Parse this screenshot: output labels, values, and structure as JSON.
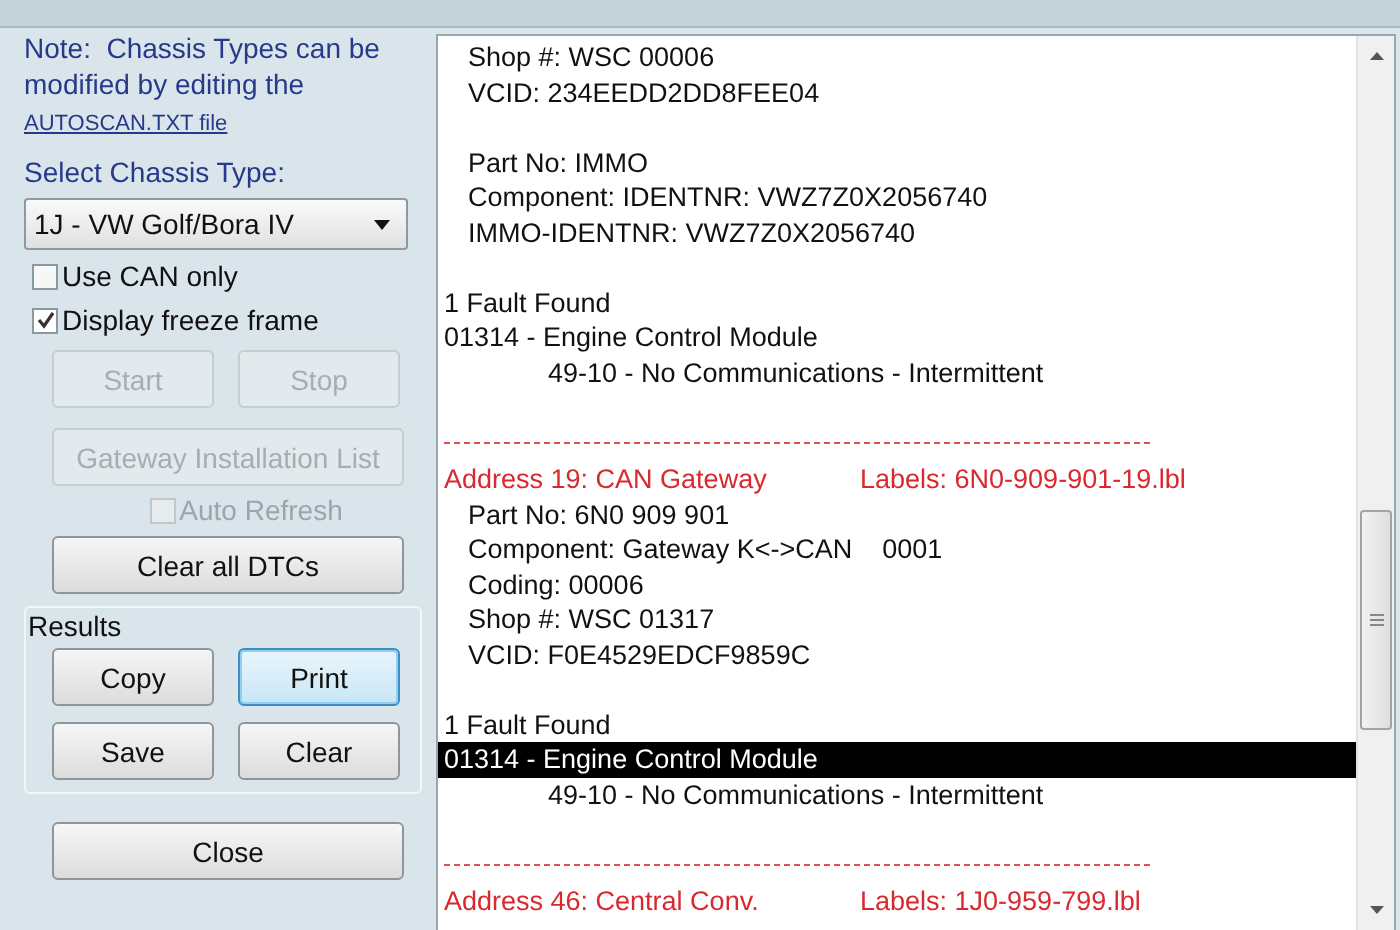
{
  "note": {
    "text": "Note:  Chassis Types can be modified by editing the",
    "link": "AUTOSCAN.TXT file"
  },
  "chassis": {
    "label": "Select Chassis Type:",
    "value": "1J - VW Golf/Bora IV"
  },
  "options": [
    {
      "label": "Use CAN only",
      "checked": false
    },
    {
      "label": "Display freeze frame",
      "checked": true
    }
  ],
  "run_buttons": [
    {
      "label": "Start",
      "disabled": true
    },
    {
      "label": "Stop",
      "disabled": true
    }
  ],
  "gateway_button": {
    "label": "Gateway Installation List",
    "disabled": true
  },
  "auto_refresh": {
    "label": "Auto Refresh",
    "checked": false,
    "disabled": true
  },
  "clear_dtcs_button": {
    "label": "Clear all DTCs",
    "disabled": false
  },
  "results": {
    "title": "Results",
    "buttons": [
      {
        "label": "Copy",
        "focused": false
      },
      {
        "label": "Print",
        "focused": true
      },
      {
        "label": "Save",
        "focused": false
      },
      {
        "label": "Clear",
        "focused": false
      }
    ]
  },
  "close_button": {
    "label": "Close"
  },
  "log": [
    {
      "kind": "field",
      "text": "Shop #: WSC 00006",
      "selected": false
    },
    {
      "kind": "field",
      "text": "VCID: 234EEDD2DD8FEE04",
      "selected": false
    },
    {
      "kind": "blank"
    },
    {
      "kind": "field",
      "text": "Part No: IMMO",
      "selected": false
    },
    {
      "kind": "field",
      "text": "Component: IDENTNR: VWZ7Z0X2056740",
      "selected": false
    },
    {
      "kind": "field",
      "text": "IMMO-IDENTNR: VWZ7Z0X2056740",
      "selected": false
    },
    {
      "kind": "blank"
    },
    {
      "kind": "plain",
      "text": "1 Fault Found",
      "selected": false
    },
    {
      "kind": "plain",
      "text": "01314 - Engine Control Module",
      "selected": false
    },
    {
      "kind": "sub",
      "text": "49-10 - No Communications - Intermittent",
      "selected": false
    },
    {
      "kind": "blank"
    },
    {
      "kind": "rule"
    },
    {
      "kind": "header",
      "text": "Address 19: CAN Gateway",
      "labels": "Labels: 6N0-909-901-19.lbl",
      "selected": false
    },
    {
      "kind": "field",
      "text": "Part No: 6N0 909 901",
      "selected": false
    },
    {
      "kind": "field",
      "text": "Component: Gateway K<->CAN    0001",
      "selected": false
    },
    {
      "kind": "field",
      "text": "Coding: 00006",
      "selected": false
    },
    {
      "kind": "field",
      "text": "Shop #: WSC 01317",
      "selected": false
    },
    {
      "kind": "field",
      "text": "VCID: F0E4529EDCF9859C",
      "selected": false
    },
    {
      "kind": "blank"
    },
    {
      "kind": "plain",
      "text": "1 Fault Found",
      "selected": false
    },
    {
      "kind": "plain",
      "text": "01314 - Engine Control Module",
      "selected": true
    },
    {
      "kind": "sub",
      "text": "49-10 - No Communications - Intermittent",
      "selected": false
    },
    {
      "kind": "blank"
    },
    {
      "kind": "rule"
    },
    {
      "kind": "header",
      "text": "Address 46: Central Conv.",
      "labels": "Labels: 1J0-959-799.lbl",
      "selected": false
    }
  ]
}
